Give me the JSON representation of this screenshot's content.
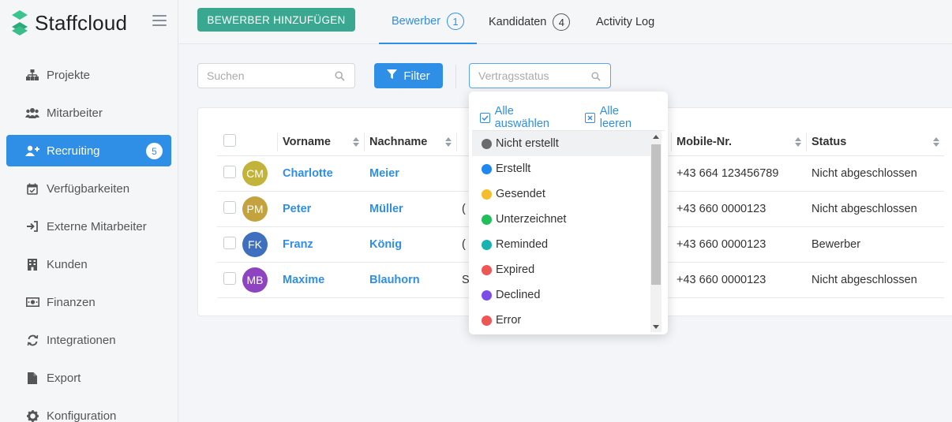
{
  "app": {
    "name": "Staffcloud"
  },
  "sidebar": {
    "items": [
      {
        "label": "Projekte",
        "icon": "sitemap-icon"
      },
      {
        "label": "Mitarbeiter",
        "icon": "users-icon"
      },
      {
        "label": "Recruiting",
        "icon": "user-plus-icon",
        "badge": "5",
        "active": true
      },
      {
        "label": "Verfügbarkeiten",
        "icon": "calendar-check-icon"
      },
      {
        "label": "Externe Mitarbeiter",
        "icon": "sign-in-icon"
      },
      {
        "label": "Kunden",
        "icon": "building-icon"
      },
      {
        "label": "Finanzen",
        "icon": "money-icon"
      },
      {
        "label": "Integrationen",
        "icon": "sync-icon"
      },
      {
        "label": "Export",
        "icon": "file-icon"
      },
      {
        "label": "Konfiguration",
        "icon": "gear-icon"
      }
    ]
  },
  "topbar": {
    "add_button": "BEWERBER HINZUFÜGEN",
    "tabs": [
      {
        "label": "Bewerber",
        "count": "1",
        "active": true
      },
      {
        "label": "Kandidaten",
        "count": "4"
      },
      {
        "label": "Activity Log"
      }
    ]
  },
  "toolbar": {
    "search_placeholder": "Suchen",
    "filter_label": "Filter",
    "status_placeholder": "Vertragsstatus"
  },
  "table": {
    "columns": [
      "Vorname",
      "Nachname",
      "",
      "Mobile-Nr.",
      "Status"
    ],
    "rows": [
      {
        "initials": "CM",
        "avatar_color": "#c2b33a",
        "first": "Charlotte",
        "last": "Meier",
        "partial": "",
        "mobile": "+43 664 123456789",
        "status": "Nicht abgeschlossen"
      },
      {
        "initials": "PM",
        "avatar_color": "#c4a33e",
        "first": "Peter",
        "last": "Müller",
        "partial": "(",
        "mobile": "+43 660 0000123",
        "status": "Nicht abgeschlossen"
      },
      {
        "initials": "FK",
        "avatar_color": "#3f6fbf",
        "first": "Franz",
        "last": "König",
        "partial": "(",
        "mobile": "+43 660 0000123",
        "status": "Bewerber"
      },
      {
        "initials": "MB",
        "avatar_color": "#8e44c0",
        "first": "Maxime",
        "last": "Blauhorn",
        "partial": "S",
        "mobile": "+43 660 0000123",
        "status": "Nicht abgeschlossen"
      }
    ]
  },
  "dropdown": {
    "select_all": "Alle auswählen",
    "clear_all": "Alle leeren",
    "options": [
      {
        "label": "Nicht erstellt",
        "color": "#6b6b6b"
      },
      {
        "label": "Erstellt",
        "color": "#1e88f0"
      },
      {
        "label": "Gesendet",
        "color": "#f5bd2a"
      },
      {
        "label": "Unterzeichnet",
        "color": "#1fbf5a"
      },
      {
        "label": "Reminded",
        "color": "#17b3b3"
      },
      {
        "label": "Expired",
        "color": "#ee5555"
      },
      {
        "label": "Declined",
        "color": "#7b4de8"
      },
      {
        "label": "Error",
        "color": "#ee5555"
      }
    ]
  },
  "colors": {
    "accent": "#2f8ee6",
    "add_button": "#3aa890"
  }
}
